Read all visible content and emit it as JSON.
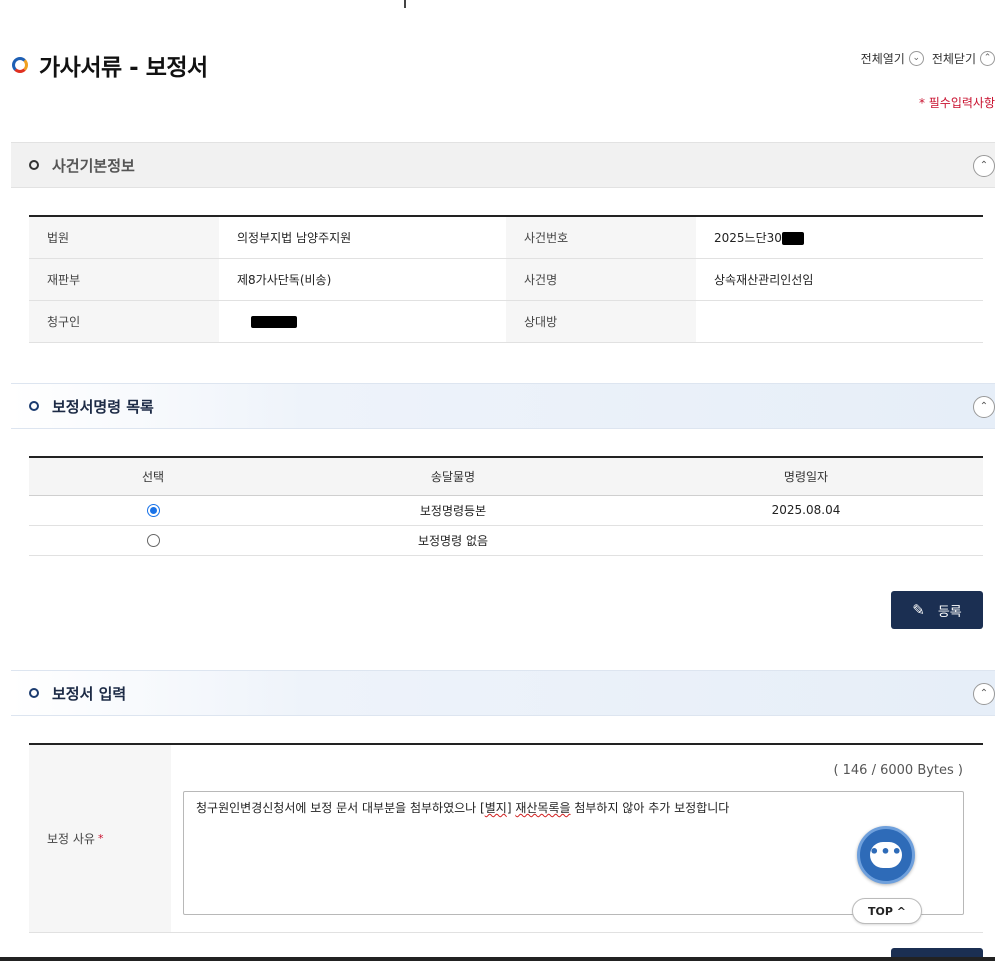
{
  "page": {
    "title": "가사서류 - 보정서",
    "expand_all": "전체열기",
    "collapse_all": "전체닫기",
    "required_note": "* 필수입력사항"
  },
  "sections": {
    "case_info": "사건기본정보",
    "order_list": "보정서명령 목록",
    "input": "보정서 입력"
  },
  "case_info": {
    "court_label": "법원",
    "court_value": "의정부지법 남양주지원",
    "case_no_label": "사건번호",
    "case_no_value": "2025느단30",
    "division_label": "재판부",
    "division_value": "제8가사단독(비송)",
    "case_name_label": "사건명",
    "case_name_value": "상속재산관리인선임",
    "claimant_label": "청구인",
    "opponent_label": "상대방",
    "opponent_value": ""
  },
  "order_table": {
    "headers": [
      "선택",
      "송달물명",
      "명령일자"
    ],
    "rows": [
      {
        "selected": true,
        "name": "보정명령등본",
        "date": "2025.08.04"
      },
      {
        "selected": false,
        "name": "보정명령 없음",
        "date": ""
      }
    ]
  },
  "register_button": "등록",
  "input_form": {
    "reason_label": "보정 사유",
    "required_mark": "*",
    "byte_count": "( 146 / 6000 Bytes )",
    "text_before": "청구원인변경신청서에 보정 문서 대부분을 첨부하였으나  [",
    "text_squiggle_1": "별지",
    "text_mid": "] ",
    "text_squiggle_2": "재산목록을",
    "text_after": " 첨부하지 않아 추가 보정합니다"
  },
  "chat_icon": "chat-bubble-icon",
  "top_button": "TOP ^"
}
